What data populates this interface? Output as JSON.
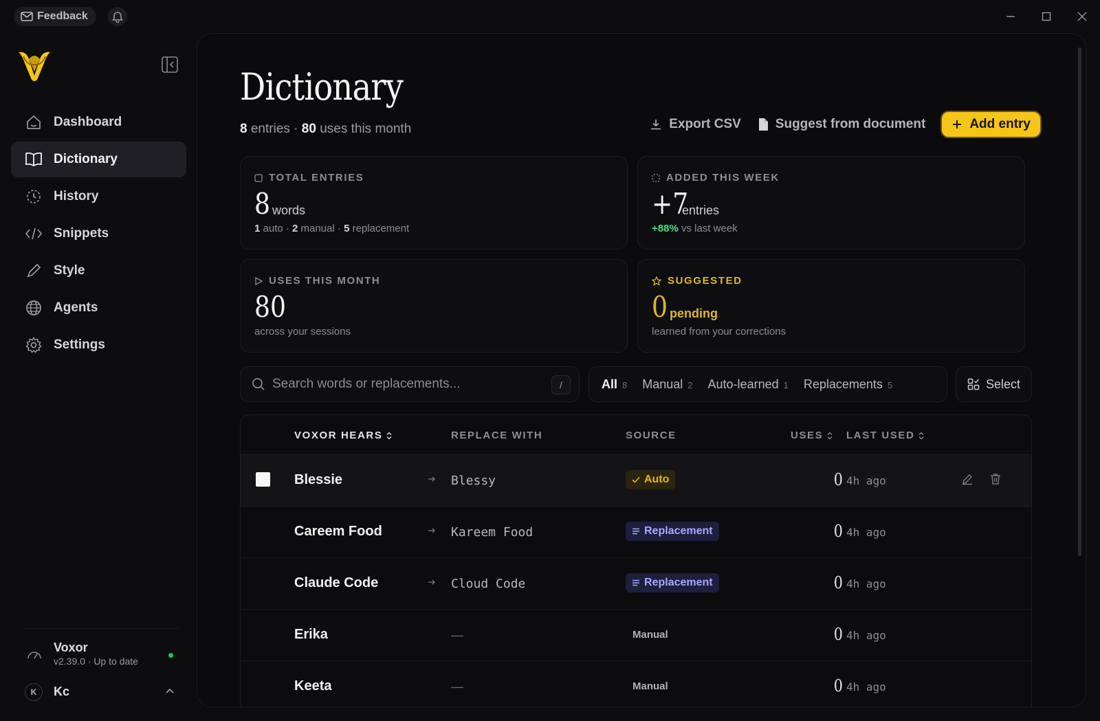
{
  "titlebar": {
    "feedback_label": "Feedback"
  },
  "sidebar": {
    "items": [
      {
        "label": "Dashboard",
        "icon": "home-icon"
      },
      {
        "label": "Dictionary",
        "icon": "book-icon",
        "active": true
      },
      {
        "label": "History",
        "icon": "history-icon"
      },
      {
        "label": "Snippets",
        "icon": "code-icon"
      },
      {
        "label": "Style",
        "icon": "pen-icon"
      },
      {
        "label": "Agents",
        "icon": "globe-icon"
      },
      {
        "label": "Settings",
        "icon": "gear-icon"
      }
    ],
    "app_name": "Voxor",
    "version": "v2.39.0 · Up to date",
    "user_initial": "K",
    "user_name": "Kc"
  },
  "page": {
    "title": "Dictionary",
    "entries_count": "8",
    "entries_text": " entries · ",
    "uses_count": "80",
    "uses_text": " uses this month",
    "export_label": "Export CSV",
    "suggest_label": "Suggest from document",
    "add_label": "Add entry"
  },
  "stats": {
    "total": {
      "label": "TOTAL ENTRIES",
      "value": "8",
      "unit": "words",
      "auto": "1",
      "auto_txt": " auto · ",
      "manual": "2",
      "manual_txt": " manual · ",
      "repl": "5",
      "repl_txt": " replacement"
    },
    "week": {
      "label": "ADDED THIS WEEK",
      "value": "+7",
      "unit": "entries",
      "delta": "+88%",
      "delta_txt": " vs last week"
    },
    "uses": {
      "label": "USES THIS MONTH",
      "value": "80",
      "sub": "across your sessions"
    },
    "suggested": {
      "label": "SUGGESTED",
      "value": "0",
      "unit": "pending",
      "sub": "learned from your corrections"
    }
  },
  "filters": {
    "search_placeholder": "Search words or replacements...",
    "shortcut": "/",
    "tabs": [
      {
        "label": "All",
        "count": "8",
        "active": true
      },
      {
        "label": "Manual",
        "count": "2"
      },
      {
        "label": "Auto-learned",
        "count": "1"
      },
      {
        "label": "Replacements",
        "count": "5"
      }
    ],
    "select_label": "Select"
  },
  "table": {
    "headers": {
      "hears": "VOXOR HEARS",
      "replace": "REPLACE WITH",
      "source": "SOURCE",
      "uses": "USES",
      "last": "LAST USED"
    },
    "rows": [
      {
        "word": "Blessie",
        "replace": "Blessy",
        "source": "Auto",
        "uses": "0",
        "last": "4h ago"
      },
      {
        "word": "Careem Food",
        "replace": "Kareem Food",
        "source": "Replacement",
        "uses": "0",
        "last": "4h ago"
      },
      {
        "word": "Claude Code",
        "replace": "Cloud Code",
        "source": "Replacement",
        "uses": "0",
        "last": "4h ago"
      },
      {
        "word": "Erika",
        "replace": "—",
        "source": "Manual",
        "uses": "0",
        "last": "4h ago"
      },
      {
        "word": "Keeta",
        "replace": "—",
        "source": "Manual",
        "uses": "0",
        "last": "4h ago"
      }
    ]
  },
  "colors": {
    "accent": "#f5c518",
    "auto": "#e6b523",
    "replacement": "#a5aaff",
    "positive": "#4ade80"
  }
}
